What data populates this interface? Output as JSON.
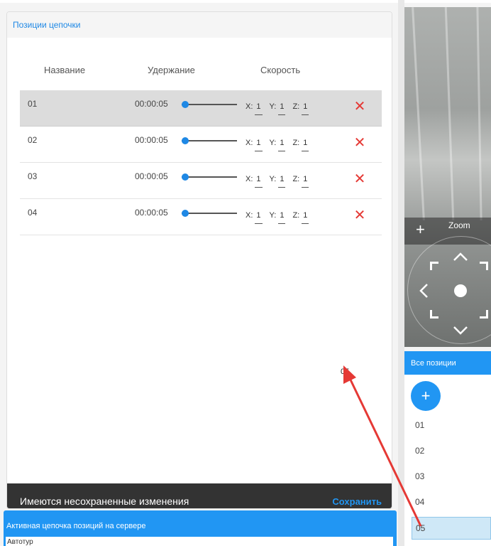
{
  "chain_panel": {
    "title": "Позиции цепочки",
    "columns": {
      "name": "Название",
      "hold": "Удержание",
      "speed": "Скорость"
    },
    "rows": [
      {
        "name": "01",
        "hold": "00:00:05",
        "hold_level": 0,
        "x": "1",
        "y": "1",
        "z": "1",
        "selected": true
      },
      {
        "name": "02",
        "hold": "00:00:05",
        "hold_level": 0,
        "x": "1",
        "y": "1",
        "z": "1",
        "selected": false
      },
      {
        "name": "03",
        "hold": "00:00:05",
        "hold_level": 0,
        "x": "1",
        "y": "1",
        "z": "1",
        "selected": false
      },
      {
        "name": "04",
        "hold": "00:00:05",
        "hold_level": 0,
        "x": "1",
        "y": "1",
        "z": "1",
        "selected": false
      }
    ],
    "axis_labels": {
      "x": "X:",
      "y": "Y:",
      "z": "Z:"
    },
    "delete_glyph": "✕",
    "dragged_label": "05",
    "unsaved_message": "Имеются несохраненные изменения",
    "save_label": "Сохранить"
  },
  "active_chain": {
    "title": "Активная цепочка позиций на сервере",
    "first_line": "Автотур"
  },
  "camera": {
    "zoom_label": "Zoom",
    "plus_glyph": "+"
  },
  "all_positions": {
    "title": "Все позиции",
    "add_glyph": "+",
    "items": [
      "01",
      "02",
      "03",
      "04",
      "05"
    ],
    "selected": "05"
  },
  "colors": {
    "accent": "#2196f3",
    "delete": "#e53935",
    "arrow": "#e53935",
    "unsaved_bar": "#333333"
  }
}
